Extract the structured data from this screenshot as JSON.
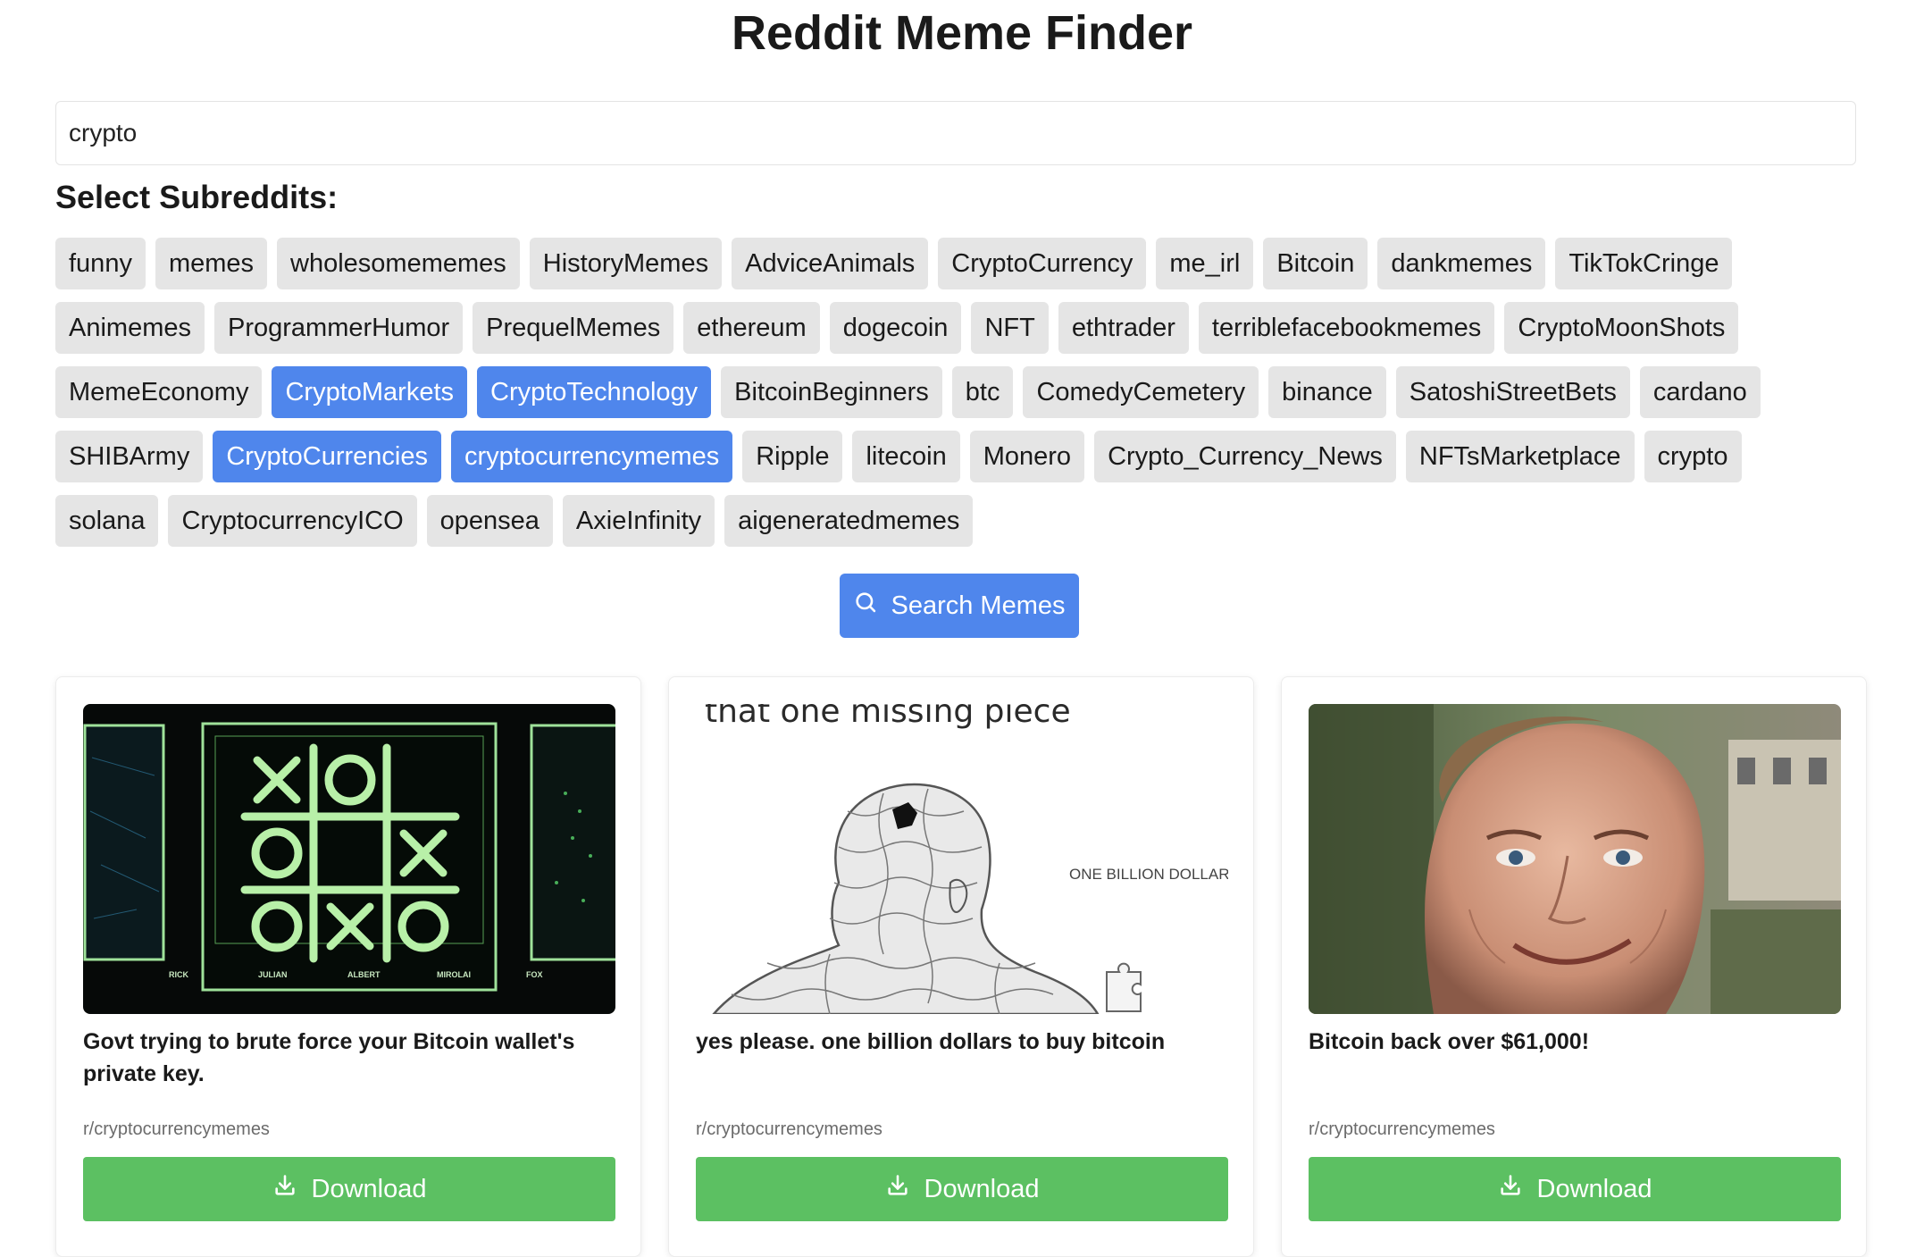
{
  "app": {
    "title": "Reddit Meme Finder"
  },
  "search": {
    "value": "crypto"
  },
  "subreddits_label": "Select Subreddits:",
  "subreddit_rows": [
    [
      {
        "label": "funny",
        "selected": false
      },
      {
        "label": "memes",
        "selected": false
      },
      {
        "label": "wholesomememes",
        "selected": false
      },
      {
        "label": "HistoryMemes",
        "selected": false
      },
      {
        "label": "AdviceAnimals",
        "selected": false
      },
      {
        "label": "CryptoCurrency",
        "selected": false
      },
      {
        "label": "me_irl",
        "selected": false
      },
      {
        "label": "Bitcoin",
        "selected": false
      },
      {
        "label": "dankmemes",
        "selected": false
      },
      {
        "label": "TikTokCringe",
        "selected": false
      }
    ],
    [
      {
        "label": "Animemes",
        "selected": false
      },
      {
        "label": "ProgrammerHumor",
        "selected": false
      },
      {
        "label": "PrequelMemes",
        "selected": false
      },
      {
        "label": "ethereum",
        "selected": false
      },
      {
        "label": "dogecoin",
        "selected": false
      },
      {
        "label": "NFT",
        "selected": false
      },
      {
        "label": "ethtrader",
        "selected": false
      },
      {
        "label": "terriblefacebookmemes",
        "selected": false
      },
      {
        "label": "CryptoMoonShots",
        "selected": false
      }
    ],
    [
      {
        "label": "MemeEconomy",
        "selected": false
      },
      {
        "label": "CryptoMarkets",
        "selected": true
      },
      {
        "label": "CryptoTechnology",
        "selected": true
      },
      {
        "label": "BitcoinBeginners",
        "selected": false
      },
      {
        "label": "btc",
        "selected": false
      },
      {
        "label": "ComedyCemetery",
        "selected": false
      },
      {
        "label": "binance",
        "selected": false
      },
      {
        "label": "SatoshiStreetBets",
        "selected": false
      },
      {
        "label": "cardano",
        "selected": false
      }
    ],
    [
      {
        "label": "SHIBArmy",
        "selected": false
      },
      {
        "label": "CryptoCurrencies",
        "selected": true
      },
      {
        "label": "cryptocurrencymemes",
        "selected": true
      },
      {
        "label": "Ripple",
        "selected": false
      },
      {
        "label": "litecoin",
        "selected": false
      },
      {
        "label": "Monero",
        "selected": false
      },
      {
        "label": "Crypto_Currency_News",
        "selected": false
      },
      {
        "label": "NFTsMarketplace",
        "selected": false
      },
      {
        "label": "crypto",
        "selected": false
      }
    ],
    [
      {
        "label": "solana",
        "selected": false
      },
      {
        "label": "CryptocurrencyICO",
        "selected": false
      },
      {
        "label": "opensea",
        "selected": false
      },
      {
        "label": "AxieInfinity",
        "selected": false
      },
      {
        "label": "aigeneratedmemes",
        "selected": false
      }
    ]
  ],
  "search_button": {
    "label": "Search Memes",
    "icon": "search-icon"
  },
  "colors": {
    "accent": "#4f86ec",
    "download": "#5cc062",
    "chip": "#e5e5e5"
  },
  "cards": [
    {
      "title": "Govt trying to brute force your Bitcoin wallet's private key.",
      "subreddit": "r/cryptocurrencymemes",
      "download_label": "Download",
      "image": {
        "labels": [
          "RICK",
          "JULIAN",
          "ALBERT",
          "MIROLAI",
          "FOX"
        ],
        "grid": [
          "X",
          "O",
          "",
          "O",
          "",
          "X",
          "O",
          "X",
          "O"
        ]
      }
    },
    {
      "title": "yes please. one billion dollars to buy bitcoin",
      "subreddit": "r/cryptocurrencymemes",
      "download_label": "Download",
      "image": {
        "caption": "that one missing piece",
        "corner_text": "ONE BILLION DOLLARS"
      }
    },
    {
      "title": "Bitcoin back over $61,000!",
      "subreddit": "r/cryptocurrencymemes",
      "download_label": "Download",
      "image": {}
    }
  ]
}
